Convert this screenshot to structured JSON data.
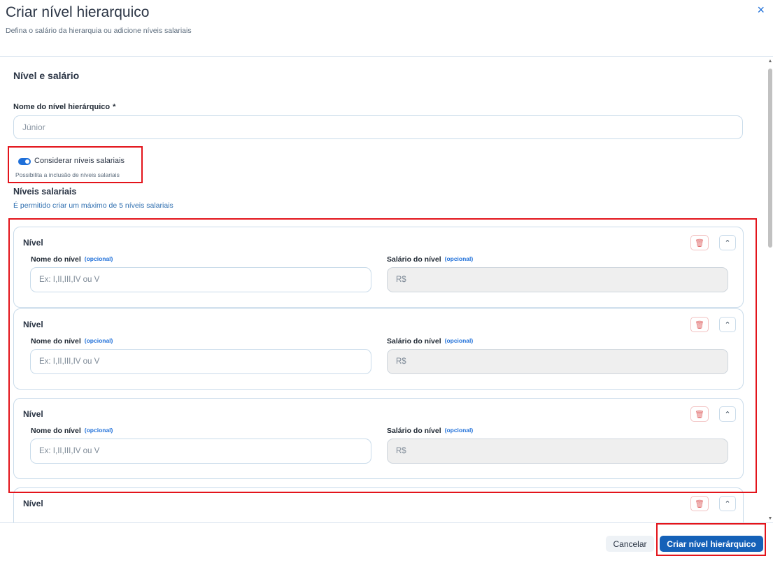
{
  "header": {
    "title": "Criar nível hierarquico",
    "subtitle": "Defina o salário da hierarquia ou adicione níveis salariais",
    "close_icon": "×"
  },
  "form": {
    "section_title": "Nível e salário",
    "name_label": "Nome do nível hierárquico",
    "required_mark": "*",
    "name_value": "Júnior",
    "toggle_label": "Considerar níveis salariais",
    "toggle_help": "Possibilita a inclusão de níveis salariais",
    "toggle_on": true,
    "levels_title": "Níveis salariais",
    "levels_help": "É permitido criar um máximo de 5 níveis salariais"
  },
  "levels": [
    {
      "title": "Nível",
      "name_label": "Nome do nível",
      "name_optional": "(opcional)",
      "name_placeholder": "Ex: I,II,III,IV ou V",
      "salary_label": "Salário do nível",
      "salary_optional": "(opcional)",
      "salary_placeholder": "R$"
    },
    {
      "title": "Nível",
      "name_label": "Nome do nível",
      "name_optional": "(opcional)",
      "name_placeholder": "Ex: I,II,III,IV ou V",
      "salary_label": "Salário do nível",
      "salary_optional": "(opcional)",
      "salary_placeholder": "R$"
    },
    {
      "title": "Nível",
      "name_label": "Nome do nível",
      "name_optional": "(opcional)",
      "name_placeholder": "Ex: I,II,III,IV ou V",
      "salary_label": "Salário do nível",
      "salary_optional": "(opcional)",
      "salary_placeholder": "R$"
    },
    {
      "title": "Nível"
    }
  ],
  "footer": {
    "cancel_label": "Cancelar",
    "submit_label": "Criar nível hierárquico"
  },
  "colors": {
    "accent": "#1e6fd9",
    "primary_button": "#1561b8",
    "highlight": "#e3141b"
  }
}
